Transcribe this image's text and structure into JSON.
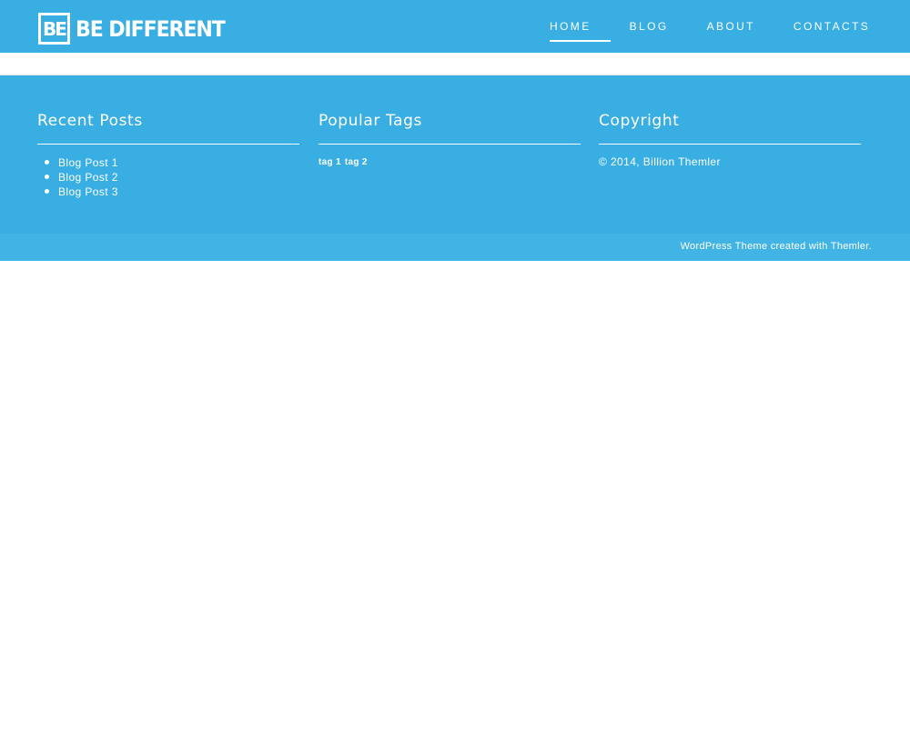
{
  "header": {
    "logo_mark": "BE",
    "logo_text": "BE DIFFERENT",
    "nav": [
      {
        "label": "HOME",
        "active": true
      },
      {
        "label": "BLOG",
        "active": false
      },
      {
        "label": "ABOUT",
        "active": false
      },
      {
        "label": "CONTACTS",
        "active": false
      }
    ]
  },
  "footer": {
    "recent_posts": {
      "title": "Recent Posts",
      "items": [
        "Blog Post 1",
        "Blog Post 2",
        "Blog Post 3"
      ]
    },
    "popular_tags": {
      "title": "Popular Tags",
      "tags": [
        "tag 1",
        "tag 2"
      ]
    },
    "copyright": {
      "title": "Copyright",
      "text": "© 2014, Billion Themler"
    }
  },
  "bottom_bar": {
    "link1": "WordPress Theme",
    "middle": " created with ",
    "link2": "Themler",
    "end": "."
  },
  "colors": {
    "accent": "#38aee2",
    "bottom_bar": "#41b3e4",
    "text": "#ffffff"
  }
}
